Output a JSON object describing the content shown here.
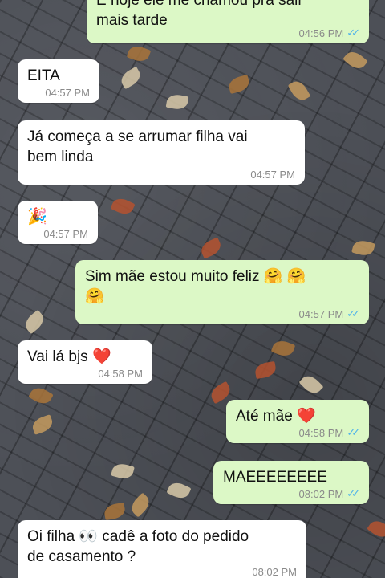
{
  "messages": [
    {
      "id": "m1",
      "dir": "out",
      "text": "E hoje ele me chamou pra sair\nmais tarde",
      "time": "04:56 PM",
      "read": true
    },
    {
      "id": "m2",
      "dir": "in",
      "text": "EITA",
      "time": "04:57 PM"
    },
    {
      "id": "m3",
      "dir": "in",
      "text": "Já começa a se arrumar filha vai\nbem linda",
      "time": "04:57 PM"
    },
    {
      "id": "m4",
      "dir": "in",
      "text": "🎉",
      "time": "04:57 PM"
    },
    {
      "id": "m5",
      "dir": "out",
      "text": "Sim mãe estou muito feliz 🤗 🤗\n🤗",
      "time": "04:57 PM",
      "read": true
    },
    {
      "id": "m6",
      "dir": "in",
      "text": "Vai lá bjs ❤️",
      "time": "04:58 PM"
    },
    {
      "id": "m7",
      "dir": "out",
      "text": "Até mãe ❤️",
      "time": "04:58 PM",
      "read": true
    },
    {
      "id": "m8",
      "dir": "out",
      "text": "MAEEEEEEEE",
      "time": "08:02 PM",
      "read": true
    },
    {
      "id": "m9",
      "dir": "in",
      "text": "Oi filha 👀 cadê a foto do pedido\nde casamento ?",
      "time": "08:02 PM"
    }
  ],
  "colors": {
    "incoming_bubble": "#ffffff",
    "outgoing_bubble": "#dcf8c6",
    "read_ticks": "#4fb3ea",
    "timestamp": "#8a8a8a"
  },
  "icons": {
    "read_receipt": "double-check-icon"
  }
}
